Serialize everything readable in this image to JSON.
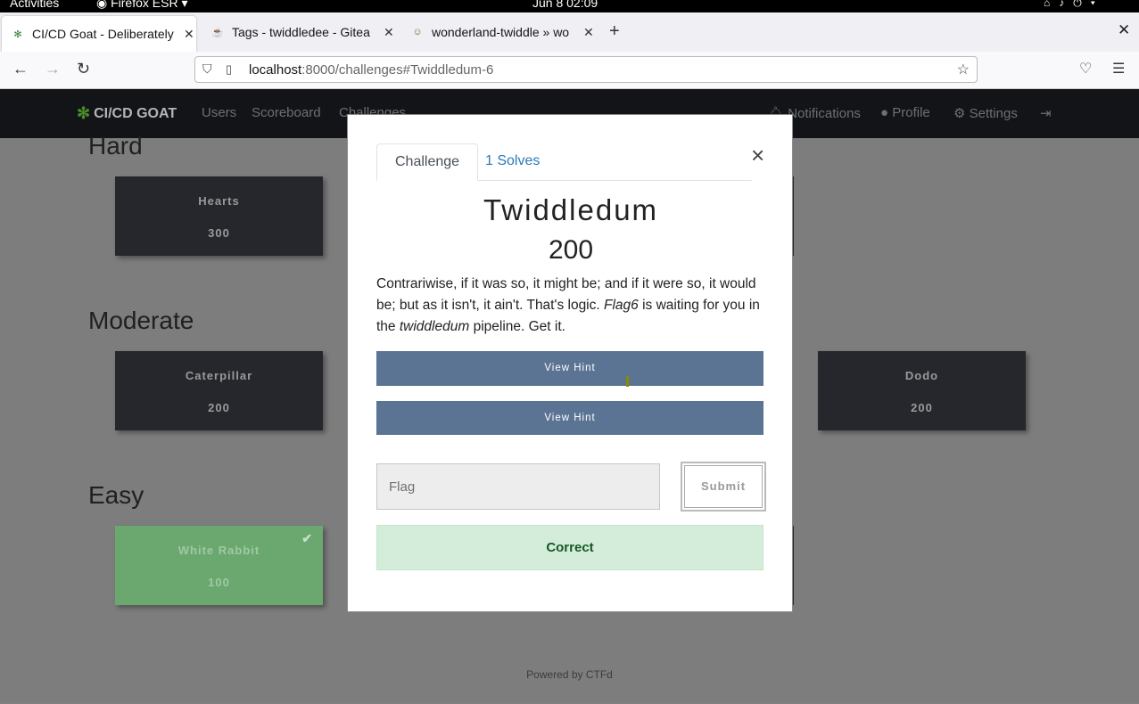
{
  "system_bar": {
    "activities": "Activities",
    "app": "Firefox ESR",
    "clock": "Jun 8  02:09"
  },
  "browser": {
    "tabs": [
      {
        "label": "CI/CD Goat - Deliberately",
        "icon": "goat-icon",
        "active": true
      },
      {
        "label": "Tags - twiddledee - Gitea",
        "icon": "gitea-icon",
        "active": false
      },
      {
        "label": "wonderland-twiddle » wo",
        "icon": "jenkins-icon",
        "active": false
      }
    ],
    "url_host": "localhost",
    "url_rest": ":8000/challenges#Twiddledum-6"
  },
  "site": {
    "brand": "CI/CD GOAT",
    "nav": [
      "Users",
      "Scoreboard",
      "Challenges"
    ],
    "nav_right": [
      "Notifications",
      "Profile",
      "Settings"
    ],
    "categories": [
      {
        "name": "Hard",
        "cards": [
          {
            "name": "Hearts",
            "value": "300"
          }
        ]
      },
      {
        "name": "Moderate",
        "cards": [
          {
            "name": "Caterpillar",
            "value": "200"
          },
          {
            "name": "Dodo",
            "value": "200"
          }
        ]
      },
      {
        "name": "Easy",
        "cards": [
          {
            "name": "White Rabbit",
            "value": "100",
            "solved": true
          }
        ]
      }
    ],
    "footer": "Powered by CTFd"
  },
  "modal": {
    "tabs": [
      "Challenge",
      "1 Solves"
    ],
    "title": "Twiddledum",
    "value": "200",
    "description_parts": {
      "p1": "Contrariwise, if it was so, it might be; and if it were so, it would be; but as it isn't, it ain't. That's logic. ",
      "flag": "Flag6",
      "p2": " is waiting for you in the ",
      "pipeline": "twiddledum",
      "p3": " pipeline. Get it."
    },
    "hints": [
      "View Hint",
      "View Hint"
    ],
    "flag_placeholder": "Flag",
    "submit": "Submit",
    "result": "Correct"
  }
}
